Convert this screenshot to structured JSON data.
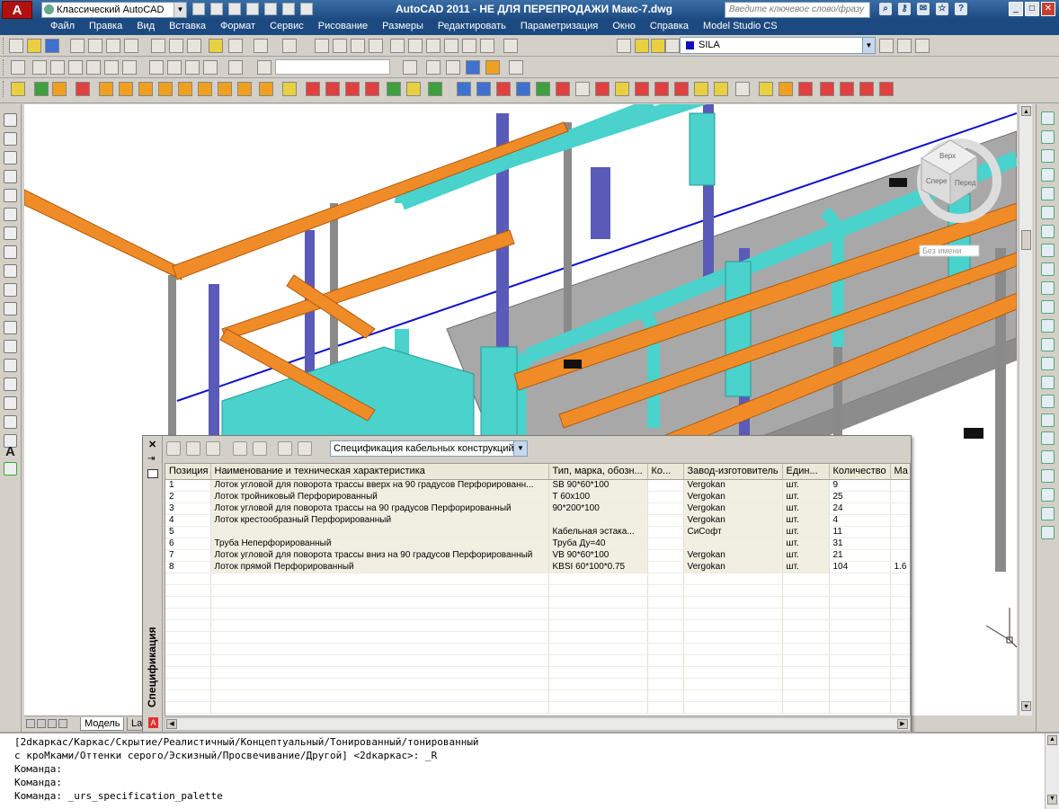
{
  "app": {
    "logo": "A",
    "title": "AutoCAD 2011 - НЕ ДЛЯ ПЕРЕПРОДАЖИ    Макс-7.dwg",
    "workspace": "Классический AutoCAD",
    "search_placeholder": "Введите ключевое слово/фразу",
    "win_min": "_",
    "win_max": "□",
    "win_close": "✕"
  },
  "menubar": {
    "items": [
      "Файл",
      "Правка",
      "Вид",
      "Вставка",
      "Формат",
      "Сервис",
      "Рисование",
      "Размеры",
      "Редактировать",
      "Параметризация",
      "Окно",
      "Справка",
      "Model Studio CS"
    ]
  },
  "layer_toolbar": {
    "current_layer": "SILA"
  },
  "viewcube": {
    "top": "Верх",
    "front": "Спере",
    "right": "Перед",
    "wcs_label": "Без имени"
  },
  "layout_tabs": {
    "model": "Модель",
    "layout": "La"
  },
  "spec_palette": {
    "title": "Спецификация",
    "spec_type": "Спецификация кабельных конструкций",
    "columns": [
      "Позиция",
      "Наименование и техническая характеристика",
      "Тип, марка, обозн...",
      "Ко...",
      "Завод-изготовитель",
      "Един...",
      "Количество",
      "Ма"
    ],
    "rows": [
      [
        "1",
        "Лоток угловой для поворота трассы вверх на 90 градусов Перфорированн...",
        "SB 90*60*100",
        "",
        "Vergokan",
        "шт.",
        "9",
        ""
      ],
      [
        "2",
        "Лоток тройниковый Перфорированный",
        "T 60x100",
        "",
        "Vergokan",
        "шт.",
        "25",
        ""
      ],
      [
        "3",
        "Лоток угловой для поворота трассы на 90 градусов Перфорированный",
        "90*200*100",
        "",
        "Vergokan",
        "шт.",
        "24",
        ""
      ],
      [
        "4",
        "Лоток крестообразный Перфорированный",
        "",
        "",
        "Vergokan",
        "шт.",
        "4",
        ""
      ],
      [
        "5",
        "",
        "Кабельная эстака...",
        "",
        "СиСофт",
        "шт.",
        "11",
        ""
      ],
      [
        "6",
        "Труба Неперфорированный",
        "Труба Ду=40",
        "",
        "",
        "шт.",
        "31",
        ""
      ],
      [
        "7",
        "Лоток угловой для поворота трассы вниз на 90 градусов Перфорированный",
        "VB 90*60*100",
        "",
        "Vergokan",
        "шт.",
        "21",
        ""
      ],
      [
        "8",
        "Лоток прямой Перфорированный",
        "KBSI 60*100*0.75",
        "",
        "Vergokan",
        "шт.",
        "104",
        "1.6"
      ]
    ]
  },
  "command_line": {
    "lines": [
      "[2dкаркас/Каркас/Скрытие/Реалистичный/Концептуальный/Тонированный/тонированный",
      "с кроМками/Оттенки серого/Эскизный/Просвечивание/Другой] <2dкаркас>: _R",
      "Команда:",
      "Команда:",
      "Команда: _urs_specification_palette"
    ]
  },
  "colors": {
    "tray": "#f08c28",
    "pipe": "#4ad2cc",
    "cable": "#1010d0",
    "deck": "#a8a8a8",
    "column": "#5a5ab8"
  }
}
